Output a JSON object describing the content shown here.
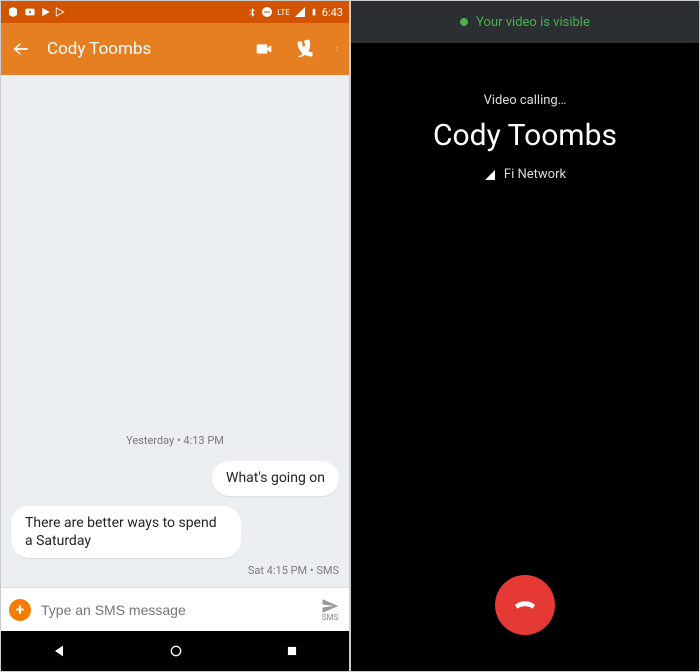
{
  "left": {
    "status_bar": {
      "time": "6:43",
      "network_label": "LTE"
    },
    "app_bar": {
      "contact_name": "Cody Toombs"
    },
    "conversation": {
      "day_header": "Yesterday • 4:13 PM",
      "messages": [
        {
          "side": "right",
          "text": "What's going on"
        },
        {
          "side": "left",
          "text": "There are better ways to spend a Saturday"
        }
      ],
      "thread_meta": "Sat 4:15 PM • SMS"
    },
    "composer": {
      "placeholder": "Type an SMS message",
      "send_label": "SMS"
    }
  },
  "right": {
    "banner": "Your video is visible",
    "call_status": "Video calling…",
    "callee_name": "Cody Toombs",
    "network": "Fi Network"
  }
}
